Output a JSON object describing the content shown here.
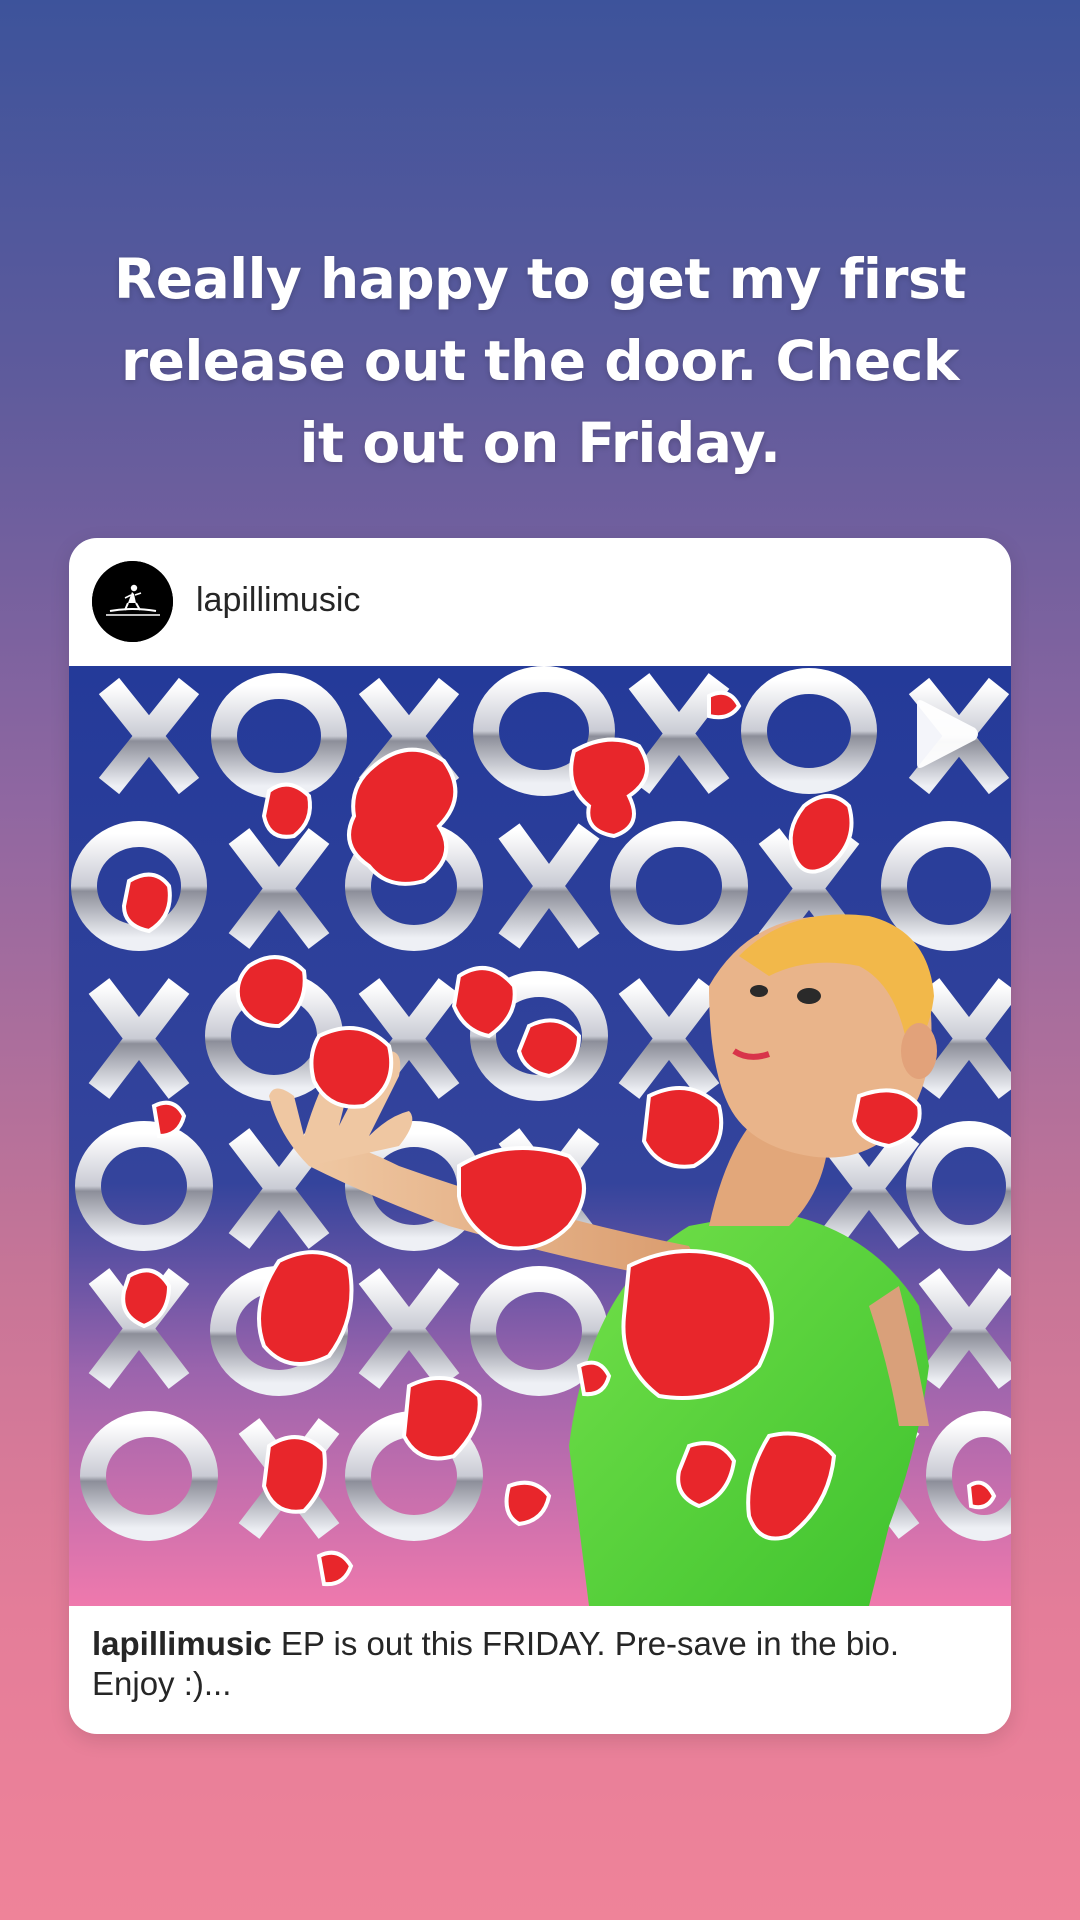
{
  "story": {
    "headline": "Really happy to get my first release out the door. Check it out on Friday.",
    "background_top": "#3d539b",
    "background_bottom": "#ef8399"
  },
  "post": {
    "username": "lapillimusic",
    "media_icon": "play-icon",
    "caption_user": "lapillimusic",
    "caption_text": " EP is out this FRIDAY. Pre-save in the bio. Enjoy :)..."
  },
  "artwork": {
    "pattern_letters": [
      "X",
      "O",
      "X",
      "O",
      "X",
      "O",
      "X"
    ],
    "colors": {
      "background": "#2f3f9a",
      "background_bottom": "#e071a8",
      "paint": "#e8262b",
      "shirt": "#56d63a",
      "skin": "#e6b48e",
      "hair": "#f2b84a"
    }
  }
}
